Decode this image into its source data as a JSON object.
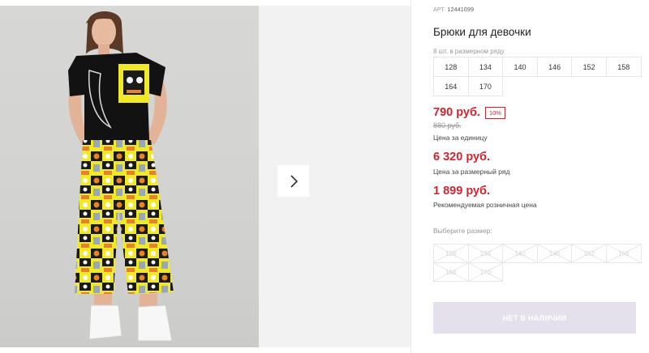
{
  "product": {
    "sku_label": "АРТ.",
    "sku": "12441099",
    "title": "Брюки для девочки"
  },
  "sizes": {
    "caption": "8 шт. в размерном ряду",
    "items": [
      "128",
      "134",
      "140",
      "146",
      "152",
      "158",
      "164",
      "170"
    ]
  },
  "pricing": {
    "price": "790 руб.",
    "discount": "10%",
    "old_price": "880 руб.",
    "unit_hint": "Цена за единицу",
    "set_price": "6 320 руб.",
    "set_hint": "Цена за размерный ряд",
    "rrp_price": "1 899 руб.",
    "rrp_hint": "Рекомендуемая розничная цена"
  },
  "size_picker": {
    "caption": "Выберите размер:",
    "items": [
      "128",
      "134",
      "140",
      "146",
      "152",
      "158",
      "164",
      "170"
    ]
  },
  "actions": {
    "buy_label": "НЕТ В НАЛИЧИИ"
  },
  "icons": {
    "next": "chevron-right-icon"
  },
  "colors": {
    "price": "#d12530",
    "disabled_button": "#e4e1ec"
  }
}
